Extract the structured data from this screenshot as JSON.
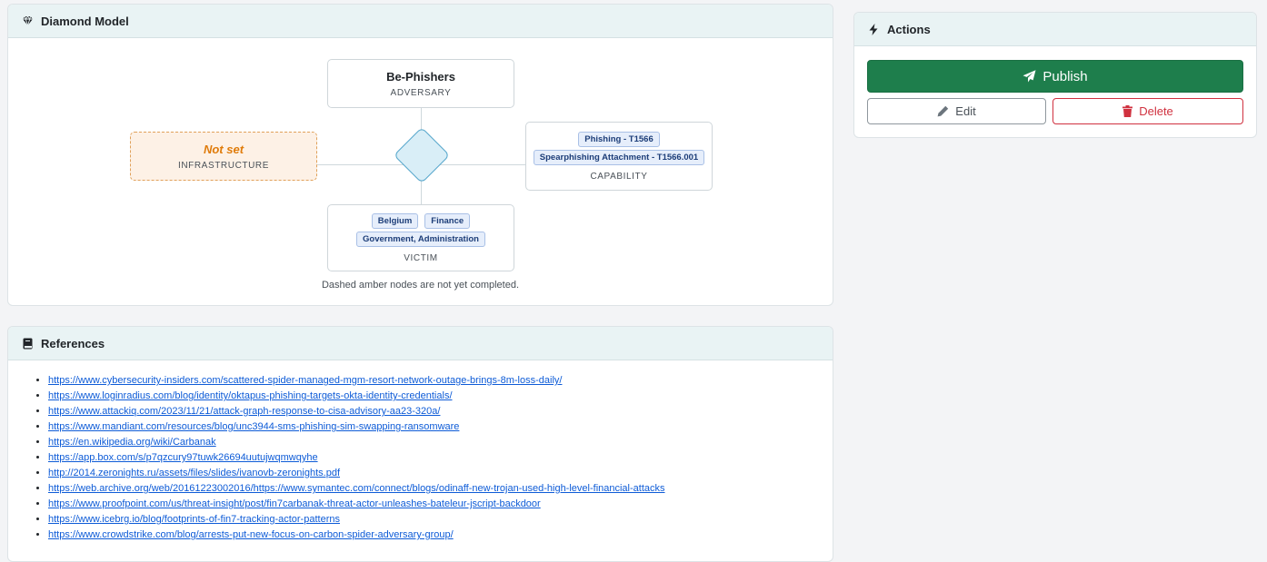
{
  "diamond_card": {
    "title": "Diamond Model",
    "icon": "gem-icon",
    "adversary": {
      "title": "Be-Phishers",
      "label": "ADVERSARY"
    },
    "infrastructure": {
      "title": "Not set",
      "label": "INFRASTRUCTURE"
    },
    "capability": {
      "tags": [
        "Phishing - T1566",
        "Spearphishing Attachment - T1566.001"
      ],
      "label": "CAPABILITY"
    },
    "victim": {
      "tags_row1": [
        "Belgium",
        "Finance"
      ],
      "tags_row2": [
        "Government, Administration"
      ],
      "label": "VICTIM"
    },
    "legend": "Dashed amber nodes are not yet completed.",
    "colors": {
      "pending_border": "#e0a15a",
      "pending_bg": "#fdf1e6",
      "pending_text": "#e07c0b",
      "center_diamond": "#d9eef7"
    }
  },
  "references_card": {
    "title": "References",
    "icon": "book-icon",
    "links": [
      "https://www.cybersecurity-insiders.com/scattered-spider-managed-mgm-resort-network-outage-brings-8m-loss-daily/",
      "https://www.loginradius.com/blog/identity/oktapus-phishing-targets-okta-identity-credentials/",
      "https://www.attackiq.com/2023/11/21/attack-graph-response-to-cisa-advisory-aa23-320a/",
      "https://www.mandiant.com/resources/blog/unc3944-sms-phishing-sim-swapping-ransomware",
      "https://en.wikipedia.org/wiki/Carbanak",
      "https://app.box.com/s/p7qzcury97tuwk26694uutujwqmwqyhe",
      "http://2014.zeronights.ru/assets/files/slides/ivanovb-zeronights.pdf",
      "https://web.archive.org/web/20161223002016/https://www.symantec.com/connect/blogs/odinaff-new-trojan-used-high-level-financial-attacks",
      "https://www.proofpoint.com/us/threat-insight/post/fin7carbanak-threat-actor-unleashes-bateleur-jscript-backdoor",
      "https://www.icebrg.io/blog/footprints-of-fin7-tracking-actor-patterns",
      "https://www.crowdstrike.com/blog/arrests-put-new-focus-on-carbon-spider-adversary-group/"
    ]
  },
  "actions_card": {
    "title": "Actions",
    "icon": "bolt-icon",
    "publish_label": "Publish",
    "edit_label": "Edit",
    "delete_label": "Delete",
    "colors": {
      "publish": "#1e7e4c",
      "delete": "#d0313f"
    }
  }
}
